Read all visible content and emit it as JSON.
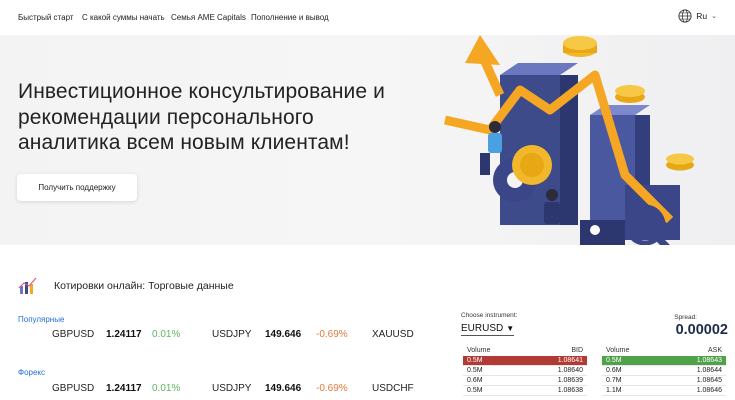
{
  "nav": {
    "items": [
      "Быстрый старт",
      "С какой суммы начать",
      "Семья AME Capitals",
      "Пополнение и вывод"
    ],
    "lang": "Ru"
  },
  "hero": {
    "headline": "Инвестиционное консультирование и рекомендации персонального аналитика всем новым клиентам!",
    "button": "Получить поддержку"
  },
  "quotes": {
    "title": "Котировки онлайн: Торговые данные",
    "categories": [
      {
        "name": "Популярные",
        "rows": [
          {
            "symbol": "GBPUSD",
            "price": "1.24117",
            "change": "0.01%",
            "dir": "up"
          },
          {
            "symbol": "USDJPY",
            "price": "149.646",
            "change": "-0.69%",
            "dir": "down"
          },
          {
            "symbol": "XAUUSD",
            "price": "",
            "change": "",
            "dir": ""
          }
        ]
      },
      {
        "name": "Форекс",
        "rows": [
          {
            "symbol": "GBPUSD",
            "price": "1.24117",
            "change": "0.01%",
            "dir": "up"
          },
          {
            "symbol": "USDJPY",
            "price": "149.646",
            "change": "-0.69%",
            "dir": "down"
          },
          {
            "symbol": "USDCHF",
            "price": "",
            "change": "",
            "dir": ""
          }
        ]
      }
    ]
  },
  "depth": {
    "choose_label": "Choose instrument:",
    "instrument": "EURUSD",
    "spread_label": "Spread:",
    "spread": "0.00002",
    "bid": {
      "headers": [
        "Volume",
        "BID"
      ],
      "rows": [
        [
          "0.5M",
          "1.08641"
        ],
        [
          "0.5M",
          "1.08640"
        ],
        [
          "0.6M",
          "1.08639"
        ],
        [
          "0.5M",
          "1.08638"
        ]
      ]
    },
    "ask": {
      "headers": [
        "Volume",
        "ASK"
      ],
      "rows": [
        [
          "0.5M",
          "1.08643"
        ],
        [
          "0.6M",
          "1.08644"
        ],
        [
          "0.7M",
          "1.08645"
        ],
        [
          "1.1M",
          "1.08646"
        ]
      ]
    }
  },
  "colors": {
    "accent": "#2a6fd6",
    "up": "#5cb85c",
    "down": "#e07b39",
    "bid_hl": "#b23a35",
    "ask_hl": "#4fa24a"
  }
}
